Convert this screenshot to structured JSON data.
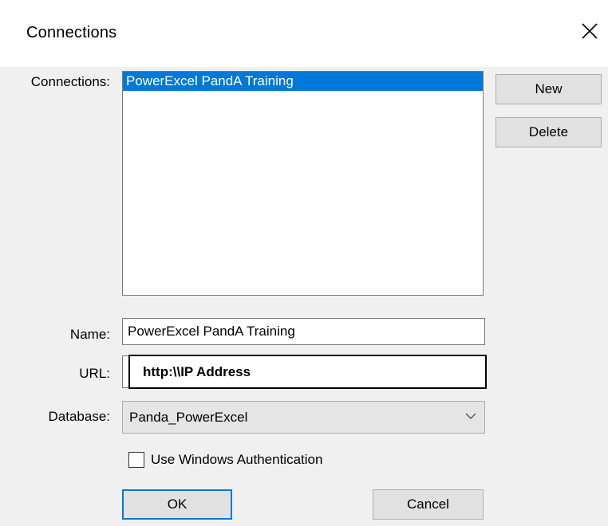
{
  "window": {
    "title": "Connections",
    "close_glyph": "×"
  },
  "connections": {
    "label": "Connections:",
    "items": [
      {
        "label": "PowerExcel PandA Training",
        "selected": true
      }
    ]
  },
  "buttons": {
    "new": "New",
    "delete": "Delete",
    "ok": "OK",
    "cancel": "Cancel"
  },
  "form": {
    "name_label": "Name:",
    "name_value": "PowerExcel PandA Training",
    "url_label": "URL:",
    "url_value": "http:\\\\IP Address",
    "database_label": "Database:",
    "database_value": "Panda_PowerExcel",
    "windows_auth_label": "Use Windows Authentication",
    "windows_auth_checked": false
  },
  "colors": {
    "selection": "#0078d7",
    "dialog_bg": "#f0f0f0",
    "button_bg": "#e1e1e1"
  },
  "icons": {
    "close": "close-icon",
    "dropdown": "chevron-down-icon"
  }
}
